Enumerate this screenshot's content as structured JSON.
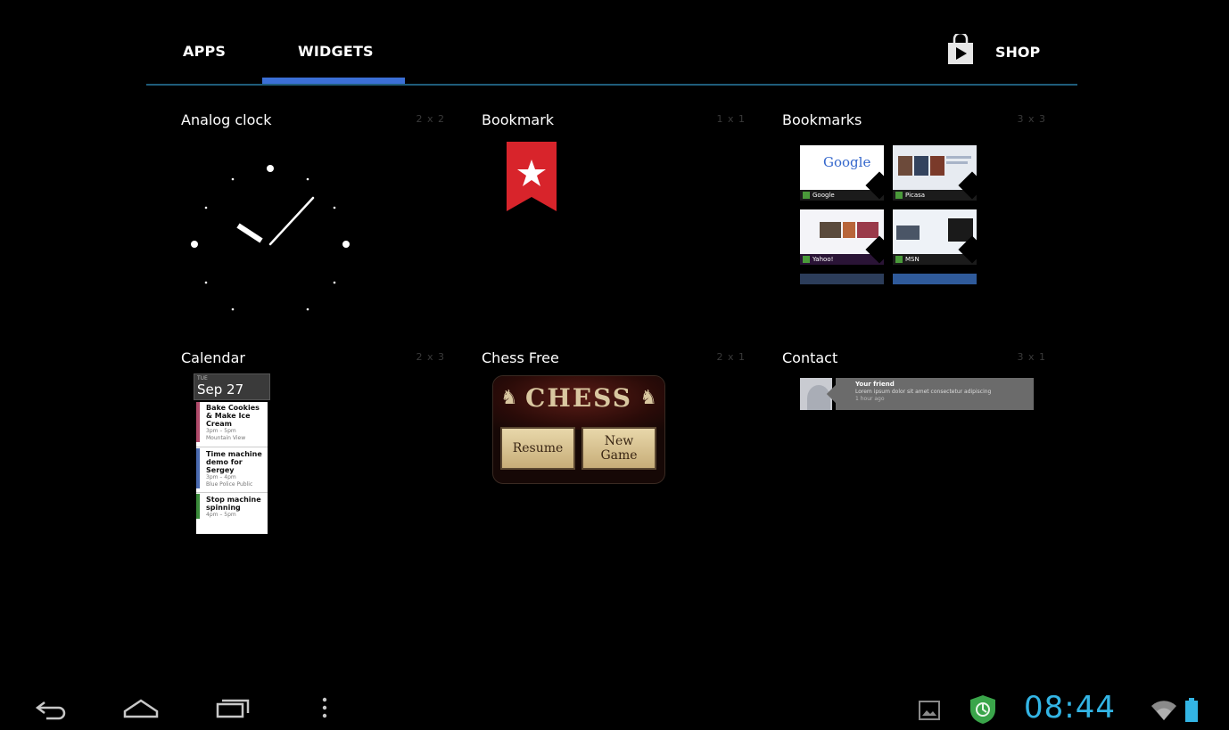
{
  "tabs": {
    "apps_label": "APPS",
    "widgets_label": "WIDGETS",
    "active": "WIDGETS"
  },
  "shop": {
    "label": "SHOP",
    "icon": "play-store-bag-icon"
  },
  "colors": {
    "accent_tab": "#3b6fd6",
    "divider": "#1f5c7a",
    "clock_blue": "#33b5e5",
    "bookmark_red": "#d8242b"
  },
  "widgets": [
    {
      "name": "Analog clock",
      "size": "2 x 2"
    },
    {
      "name": "Bookmark",
      "size": "1 x 1"
    },
    {
      "name": "Bookmarks",
      "size": "3 x 3"
    },
    {
      "name": "Calendar",
      "size": "2 x 3"
    },
    {
      "name": "Chess Free",
      "size": "2 x 1"
    },
    {
      "name": "Contact",
      "size": "3 x 1"
    }
  ],
  "bookmarks_preview": {
    "tiles": [
      "Google",
      "Picasa",
      "Yahoo!",
      "MSN"
    ],
    "google_logo_text": "Google"
  },
  "calendar_preview": {
    "day": "TUE",
    "date": "Sep 27",
    "events": [
      {
        "title": "Bake Cookies & Make Ice Cream",
        "time": "3pm – 5pm",
        "place": "Mountain View"
      },
      {
        "title": "Time machine demo for Sergey",
        "time": "3pm – 4pm",
        "place": "Blue Police Public"
      },
      {
        "title": "Stop machine spinning",
        "time": "4pm – 5pm",
        "place": ""
      }
    ]
  },
  "chess_preview": {
    "title": "CHESS",
    "resume_label": "Resume",
    "new_game_label": "New Game"
  },
  "contact_preview": {
    "name": "Your friend",
    "status": "Lorem ipsum dolor sit amet consectetur adipiscing",
    "time": "1 hour ago"
  },
  "system_bar": {
    "time": "08:44",
    "nav_icons": [
      "back-icon",
      "home-icon",
      "recent-apps-icon",
      "menu-overflow-icon"
    ],
    "status_icons": [
      "gallery-notification-icon",
      "security-shield-icon",
      "wifi-icon",
      "battery-icon"
    ]
  }
}
